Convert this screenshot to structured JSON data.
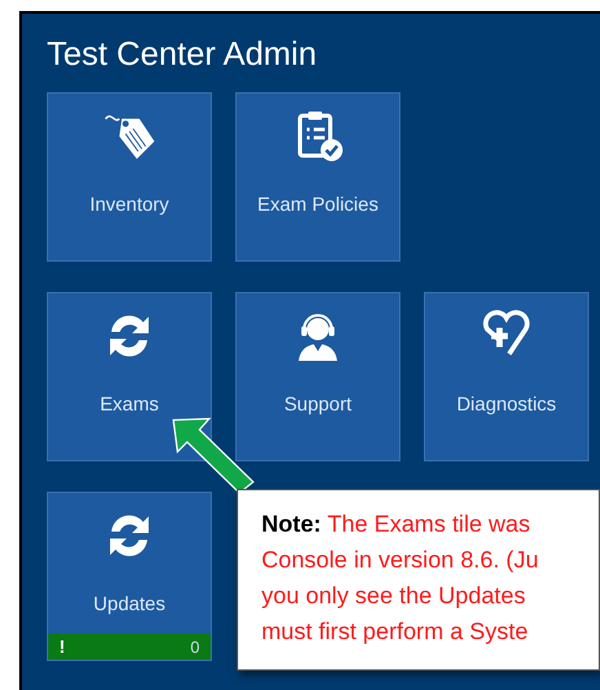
{
  "title": "Test Center Admin",
  "tile_rows": [
    [
      {
        "label": "Inventory"
      },
      {
        "label": "Exam Policies"
      }
    ],
    [
      {
        "label": "Exams"
      },
      {
        "label": "Support"
      },
      {
        "label": "Diagnostics"
      }
    ],
    [
      {
        "label": "Updates",
        "status": {
          "alert": "!",
          "count": "0"
        }
      }
    ]
  ],
  "callout": {
    "lines": [
      "**Note:** The Exams tile was",
      "Console in version 8.6. (Ju",
      "you only see the Updates",
      "must first perform a Syste"
    ]
  }
}
